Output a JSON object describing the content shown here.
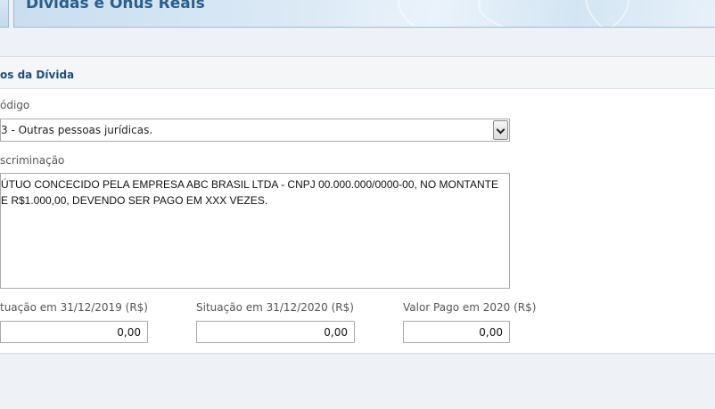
{
  "header": {
    "title": "Dívidas e Ônus Reais"
  },
  "panel": {
    "title": "os da Dívida",
    "codigo": {
      "label": "ódigo",
      "selected": "3 - Outras pessoas jurídicas."
    },
    "discriminacao": {
      "label": "scriminação",
      "line1": "ÚTUO CONCECIDO PELA EMPRESA ABC BRASIL LTDA - CNPJ 00.000.000/0000-00, NO MONTANTE",
      "line2": "E R$1.000,00, DEVENDO SER PAGO EM XXX VEZES."
    },
    "situacao_2019": {
      "label": "tuação em 31/12/2019 (R$)",
      "value": "0,00"
    },
    "situacao_2020": {
      "label": "Situação em 31/12/2020 (R$)",
      "value": "0,00"
    },
    "valor_pago": {
      "label": "Valor Pago em 2020 (R$)",
      "value": "0,00"
    }
  }
}
